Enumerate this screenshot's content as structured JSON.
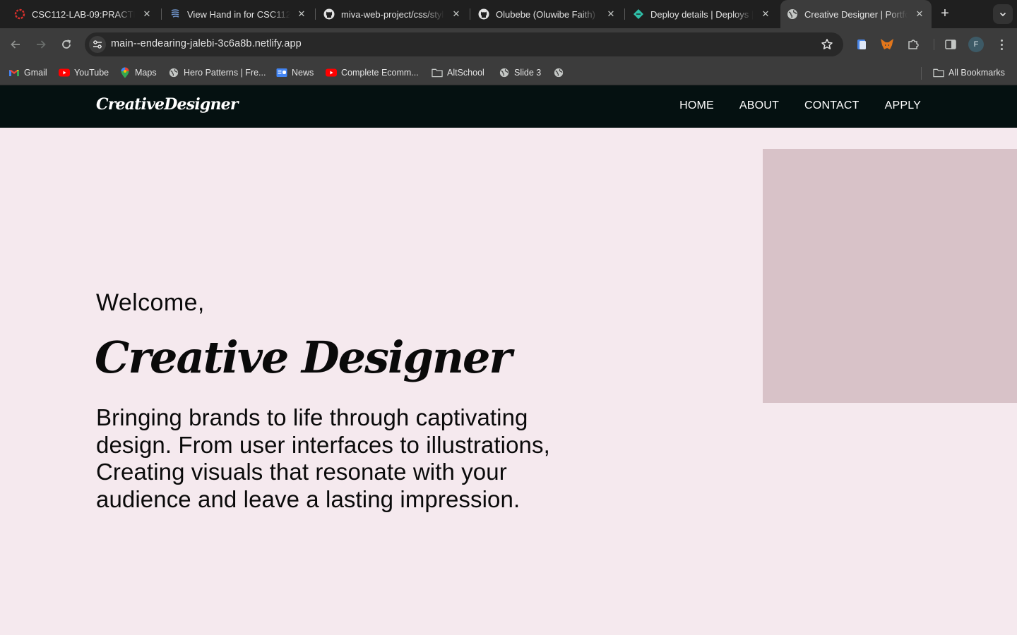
{
  "browser": {
    "tabs": [
      {
        "title": "CSC112-LAB-09:PRACTICAL",
        "icon": "red-gear-favicon-icon"
      },
      {
        "title": "View Hand in for CSC112-LAB",
        "icon": "book-favicon-icon"
      },
      {
        "title": "miva-web-project/css/style.css",
        "icon": "github-icon"
      },
      {
        "title": "Olubebe (Oluwibe Faith)",
        "icon": "github-icon"
      },
      {
        "title": "Deploy details | Deploys | Netlify",
        "icon": "netlify-icon"
      },
      {
        "title": "Creative Designer | Portfolio",
        "icon": "globe-icon",
        "active": true
      }
    ],
    "url": "main--endearing-jalebi-3c6a8b.netlify.app",
    "profile_initial": "F",
    "bookmarks": [
      {
        "label": "Gmail",
        "icon": "gmail-icon"
      },
      {
        "label": "YouTube",
        "icon": "youtube-icon"
      },
      {
        "label": "Maps",
        "icon": "maps-pin-icon"
      },
      {
        "label": "Hero Patterns | Fre...",
        "icon": "globe-icon"
      },
      {
        "label": "News",
        "icon": "google-news-icon"
      },
      {
        "label": "Complete Ecomm...",
        "icon": "youtube-icon"
      },
      {
        "label": "AltSchool",
        "icon": "folder-icon"
      },
      {
        "label": "Slide 3",
        "icon": "globe-icon"
      },
      {
        "label": "",
        "icon": "globe-icon"
      }
    ],
    "all_bookmarks": "All Bookmarks"
  },
  "site": {
    "logo": "CreativeDesigner",
    "nav": [
      "HOME",
      "ABOUT",
      "CONTACT",
      "APPLY"
    ],
    "welcome": "Welcome,",
    "headline": "Creative Designer",
    "tagline": "Bringing brands to life through captivating design. From user interfaces to illustrations, Creating visuals that resonate with your audience and leave a lasting impression."
  },
  "colors": {
    "nav_bg": "#051111",
    "page_bg": "#f5e9ee",
    "hero_block": "#d8c2c8"
  }
}
